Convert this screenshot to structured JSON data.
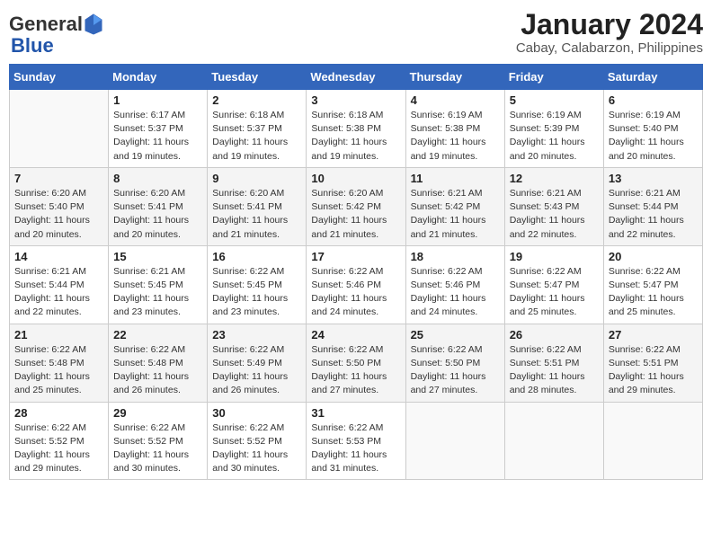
{
  "header": {
    "logo_general": "General",
    "logo_blue": "Blue",
    "title": "January 2024",
    "subtitle": "Cabay, Calabarzon, Philippines"
  },
  "days_of_week": [
    "Sunday",
    "Monday",
    "Tuesday",
    "Wednesday",
    "Thursday",
    "Friday",
    "Saturday"
  ],
  "weeks": [
    [
      {
        "num": "",
        "detail": ""
      },
      {
        "num": "1",
        "detail": "Sunrise: 6:17 AM\nSunset: 5:37 PM\nDaylight: 11 hours\nand 19 minutes."
      },
      {
        "num": "2",
        "detail": "Sunrise: 6:18 AM\nSunset: 5:37 PM\nDaylight: 11 hours\nand 19 minutes."
      },
      {
        "num": "3",
        "detail": "Sunrise: 6:18 AM\nSunset: 5:38 PM\nDaylight: 11 hours\nand 19 minutes."
      },
      {
        "num": "4",
        "detail": "Sunrise: 6:19 AM\nSunset: 5:38 PM\nDaylight: 11 hours\nand 19 minutes."
      },
      {
        "num": "5",
        "detail": "Sunrise: 6:19 AM\nSunset: 5:39 PM\nDaylight: 11 hours\nand 20 minutes."
      },
      {
        "num": "6",
        "detail": "Sunrise: 6:19 AM\nSunset: 5:40 PM\nDaylight: 11 hours\nand 20 minutes."
      }
    ],
    [
      {
        "num": "7",
        "detail": "Sunrise: 6:20 AM\nSunset: 5:40 PM\nDaylight: 11 hours\nand 20 minutes."
      },
      {
        "num": "8",
        "detail": "Sunrise: 6:20 AM\nSunset: 5:41 PM\nDaylight: 11 hours\nand 20 minutes."
      },
      {
        "num": "9",
        "detail": "Sunrise: 6:20 AM\nSunset: 5:41 PM\nDaylight: 11 hours\nand 21 minutes."
      },
      {
        "num": "10",
        "detail": "Sunrise: 6:20 AM\nSunset: 5:42 PM\nDaylight: 11 hours\nand 21 minutes."
      },
      {
        "num": "11",
        "detail": "Sunrise: 6:21 AM\nSunset: 5:42 PM\nDaylight: 11 hours\nand 21 minutes."
      },
      {
        "num": "12",
        "detail": "Sunrise: 6:21 AM\nSunset: 5:43 PM\nDaylight: 11 hours\nand 22 minutes."
      },
      {
        "num": "13",
        "detail": "Sunrise: 6:21 AM\nSunset: 5:44 PM\nDaylight: 11 hours\nand 22 minutes."
      }
    ],
    [
      {
        "num": "14",
        "detail": "Sunrise: 6:21 AM\nSunset: 5:44 PM\nDaylight: 11 hours\nand 22 minutes."
      },
      {
        "num": "15",
        "detail": "Sunrise: 6:21 AM\nSunset: 5:45 PM\nDaylight: 11 hours\nand 23 minutes."
      },
      {
        "num": "16",
        "detail": "Sunrise: 6:22 AM\nSunset: 5:45 PM\nDaylight: 11 hours\nand 23 minutes."
      },
      {
        "num": "17",
        "detail": "Sunrise: 6:22 AM\nSunset: 5:46 PM\nDaylight: 11 hours\nand 24 minutes."
      },
      {
        "num": "18",
        "detail": "Sunrise: 6:22 AM\nSunset: 5:46 PM\nDaylight: 11 hours\nand 24 minutes."
      },
      {
        "num": "19",
        "detail": "Sunrise: 6:22 AM\nSunset: 5:47 PM\nDaylight: 11 hours\nand 25 minutes."
      },
      {
        "num": "20",
        "detail": "Sunrise: 6:22 AM\nSunset: 5:47 PM\nDaylight: 11 hours\nand 25 minutes."
      }
    ],
    [
      {
        "num": "21",
        "detail": "Sunrise: 6:22 AM\nSunset: 5:48 PM\nDaylight: 11 hours\nand 25 minutes."
      },
      {
        "num": "22",
        "detail": "Sunrise: 6:22 AM\nSunset: 5:48 PM\nDaylight: 11 hours\nand 26 minutes."
      },
      {
        "num": "23",
        "detail": "Sunrise: 6:22 AM\nSunset: 5:49 PM\nDaylight: 11 hours\nand 26 minutes."
      },
      {
        "num": "24",
        "detail": "Sunrise: 6:22 AM\nSunset: 5:50 PM\nDaylight: 11 hours\nand 27 minutes."
      },
      {
        "num": "25",
        "detail": "Sunrise: 6:22 AM\nSunset: 5:50 PM\nDaylight: 11 hours\nand 27 minutes."
      },
      {
        "num": "26",
        "detail": "Sunrise: 6:22 AM\nSunset: 5:51 PM\nDaylight: 11 hours\nand 28 minutes."
      },
      {
        "num": "27",
        "detail": "Sunrise: 6:22 AM\nSunset: 5:51 PM\nDaylight: 11 hours\nand 29 minutes."
      }
    ],
    [
      {
        "num": "28",
        "detail": "Sunrise: 6:22 AM\nSunset: 5:52 PM\nDaylight: 11 hours\nand 29 minutes."
      },
      {
        "num": "29",
        "detail": "Sunrise: 6:22 AM\nSunset: 5:52 PM\nDaylight: 11 hours\nand 30 minutes."
      },
      {
        "num": "30",
        "detail": "Sunrise: 6:22 AM\nSunset: 5:52 PM\nDaylight: 11 hours\nand 30 minutes."
      },
      {
        "num": "31",
        "detail": "Sunrise: 6:22 AM\nSunset: 5:53 PM\nDaylight: 11 hours\nand 31 minutes."
      },
      {
        "num": "",
        "detail": ""
      },
      {
        "num": "",
        "detail": ""
      },
      {
        "num": "",
        "detail": ""
      }
    ]
  ]
}
